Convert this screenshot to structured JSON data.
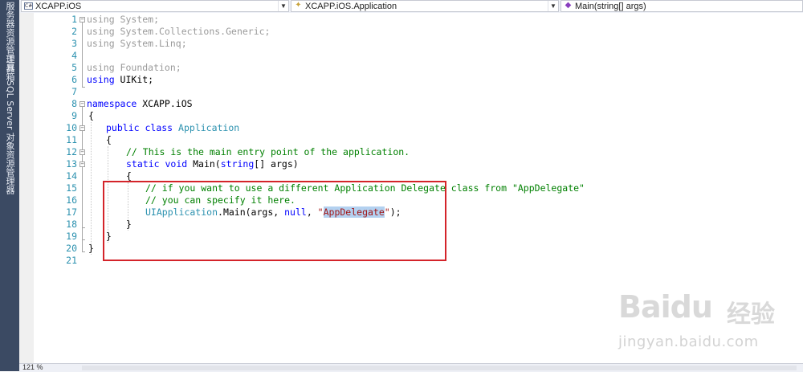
{
  "side_tabs": [
    {
      "label": "服务器资源管理器"
    },
    {
      "label": "工具箱"
    },
    {
      "label": "SQL Server 对象资源管理器"
    }
  ],
  "toolbar": {
    "project": "XCAPP.iOS",
    "class": "XCAPP.iOS.Application",
    "member": "Main(string[] args)"
  },
  "editor": {
    "line_numbers": [
      "1",
      "2",
      "3",
      "4",
      "5",
      "6",
      "7",
      "8",
      "9",
      "10",
      "11",
      "12",
      "13",
      "14",
      "15",
      "16",
      "17",
      "18",
      "19",
      "20",
      "21"
    ],
    "lines": {
      "l1": {
        "kw": "using",
        "rest": " System;"
      },
      "l2": {
        "kw": "using",
        "rest": " System.Collections.Generic;"
      },
      "l3": {
        "kw": "using",
        "rest": " System.Linq;"
      },
      "l5": {
        "kw": "using",
        "rest": " Foundation;"
      },
      "l6": {
        "kw": "using",
        "rest": " UIKit;"
      },
      "l8": {
        "kw": "namespace",
        "rest": " XCAPP.iOS"
      },
      "l9": "{",
      "l10": {
        "kw1": "public",
        "kw2": "class",
        "type": "Application"
      },
      "l11": "{",
      "l12": "// This is the main entry point of the application.",
      "l13": {
        "kw1": "static",
        "kw2": "void",
        "rest": " Main(",
        "kw3": "string",
        "rest2": "[] args)"
      },
      "l14": "{",
      "l15": "// if you want to use a different Application Delegate class from \"AppDelegate\"",
      "l16": "// you can specify it here.",
      "l17": {
        "type": "UIApplication",
        "mid": ".Main(args, ",
        "kw": "null",
        "comma": ", ",
        "q1": "\"",
        "sel": "AppDelegate",
        "q2": "\"",
        "end": ");"
      },
      "l18": "}",
      "l19": "}",
      "l20": "}"
    }
  },
  "status": {
    "zoom": "121 %"
  },
  "watermark": {
    "logo": "Baidu",
    "cn": "经验",
    "url": "jingyan.baidu.com"
  },
  "colors": {
    "keyword": "#0000ff",
    "type": "#2b91af",
    "comment": "#008000",
    "string": "#a31515",
    "highlight_box": "#d4242a",
    "line_numbers": "#2b91af"
  }
}
